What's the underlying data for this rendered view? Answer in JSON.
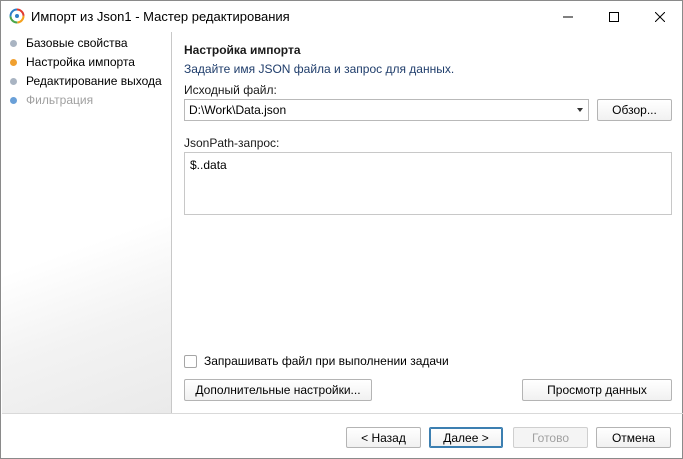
{
  "window": {
    "title": "Импорт из Json1 - Мастер редактирования"
  },
  "sidebar": {
    "steps": [
      {
        "label": "Базовые свойства",
        "dot_color": "#a9b4c2",
        "state": "done"
      },
      {
        "label": "Настройка импорта",
        "dot_color": "#f0a030",
        "state": "current"
      },
      {
        "label": "Редактирование выхода",
        "dot_color": "#a9b4c2",
        "state": "pending"
      },
      {
        "label": "Фильтрация",
        "dot_color": "#6aa0d8",
        "state": "disabled"
      }
    ]
  },
  "main": {
    "section_title": "Настройка импорта",
    "section_desc": "Задайте имя JSON файла и запрос для данных.",
    "source_label": "Исходный файл:",
    "source_value": "D:\\Work\\Data.json",
    "browse_label": "Обзор...",
    "query_label": "JsonPath-запрос:",
    "query_value": "$..data",
    "ask_file_label": "Запрашивать файл при выполнении задачи",
    "ask_file_checked": false,
    "advanced_label": "Дополнительные настройки...",
    "preview_label": "Просмотр данных"
  },
  "footer": {
    "back_label": "< Назад",
    "next_label": "Далее >",
    "finish_label": "Готово",
    "cancel_label": "Отмена"
  },
  "colors": {
    "accent": "#3c7fb1",
    "description_text": "#1f3d6b",
    "disabled_text": "#a0a0a0"
  }
}
